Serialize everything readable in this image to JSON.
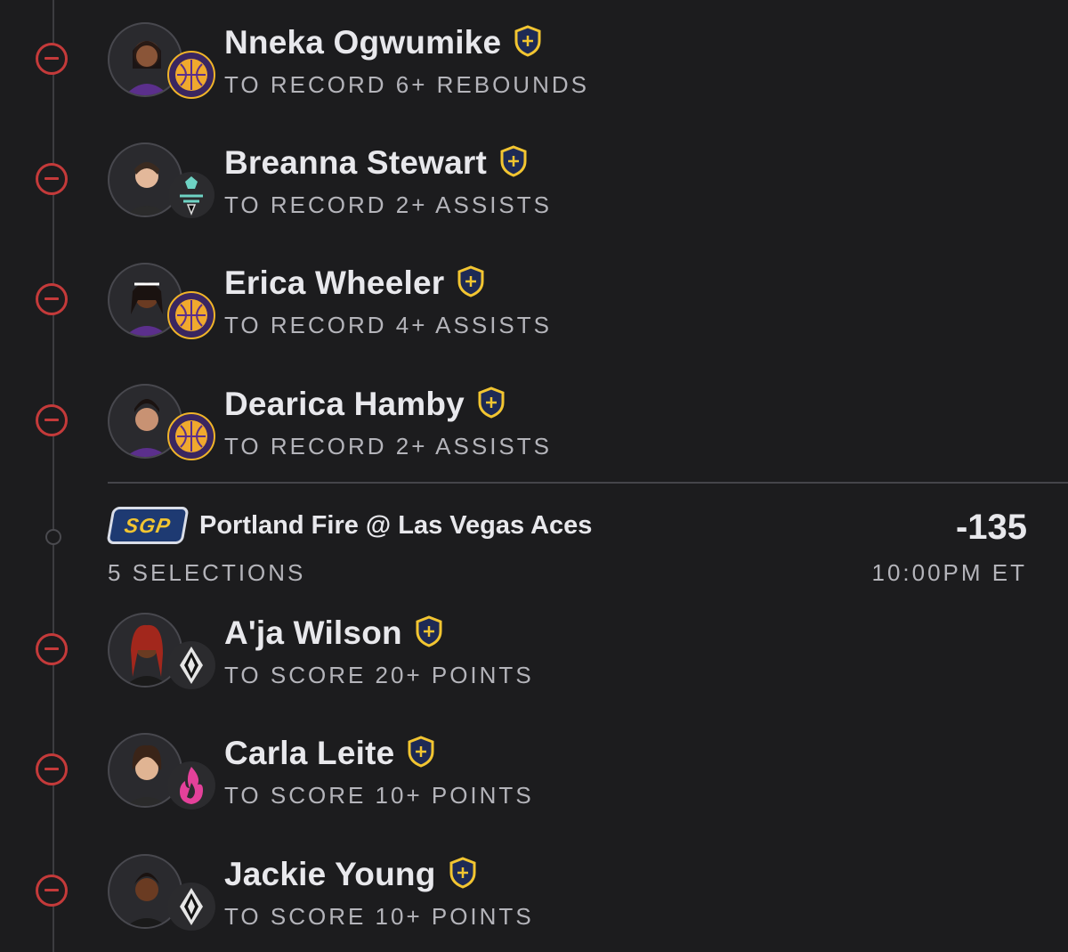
{
  "colors": {
    "background": "#1c1c1e",
    "remove_red": "#c43a3a",
    "shield_gold": "#f2c531",
    "shield_navy": "#1e2a55"
  },
  "legs_top": [
    {
      "player": "Nneka Ogwumike",
      "prop": "TO RECORD 6+ REBOUNDS",
      "team_icon": "la-sparks-logo-icon"
    },
    {
      "player": "Breanna Stewart",
      "prop": "TO RECORD 2+ ASSISTS",
      "team_icon": "ny-liberty-logo-icon"
    },
    {
      "player": "Erica Wheeler",
      "prop": "TO RECORD 4+ ASSISTS",
      "team_icon": "la-sparks-logo-icon"
    },
    {
      "player": "Dearica Hamby",
      "prop": "TO RECORD 2+ ASSISTS",
      "team_icon": "la-sparks-logo-icon"
    }
  ],
  "game": {
    "badge": "SGP",
    "matchup": "Portland Fire @ Las Vegas Aces",
    "odds": "-135",
    "selections": "5 SELECTIONS",
    "time": "10:00PM ET"
  },
  "legs_bottom": [
    {
      "player": "A'ja Wilson",
      "prop": "TO SCORE 20+ POINTS",
      "team_icon": "las-vegas-aces-logo-icon"
    },
    {
      "player": "Carla Leite",
      "prop": "TO SCORE 10+ POINTS",
      "team_icon": "portland-fire-logo-icon"
    },
    {
      "player": "Jackie Young",
      "prop": "TO SCORE 10+ POINTS",
      "team_icon": "las-vegas-aces-logo-icon"
    }
  ]
}
